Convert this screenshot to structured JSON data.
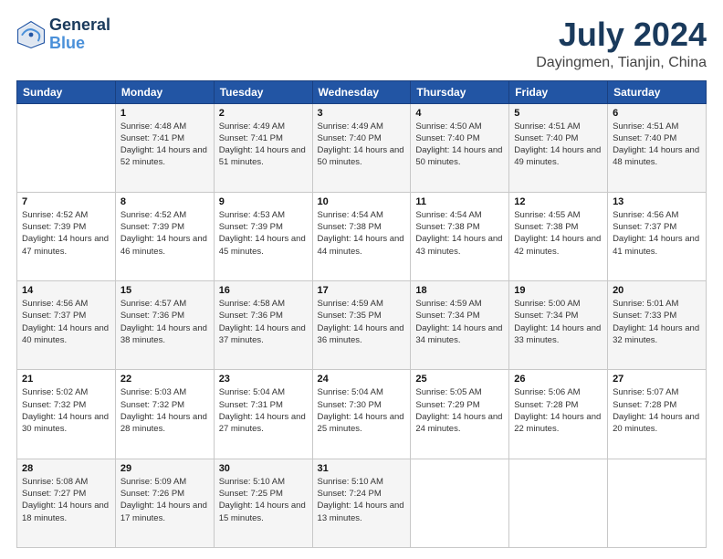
{
  "logo": {
    "line1": "General",
    "line2": "Blue"
  },
  "title": {
    "month_year": "July 2024",
    "location": "Dayingmen, Tianjin, China"
  },
  "days_header": [
    "Sunday",
    "Monday",
    "Tuesday",
    "Wednesday",
    "Thursday",
    "Friday",
    "Saturday"
  ],
  "weeks": [
    [
      {
        "day": "",
        "sunrise": "",
        "sunset": "",
        "daylight": ""
      },
      {
        "day": "1",
        "sunrise": "Sunrise: 4:48 AM",
        "sunset": "Sunset: 7:41 PM",
        "daylight": "Daylight: 14 hours and 52 minutes."
      },
      {
        "day": "2",
        "sunrise": "Sunrise: 4:49 AM",
        "sunset": "Sunset: 7:41 PM",
        "daylight": "Daylight: 14 hours and 51 minutes."
      },
      {
        "day": "3",
        "sunrise": "Sunrise: 4:49 AM",
        "sunset": "Sunset: 7:40 PM",
        "daylight": "Daylight: 14 hours and 50 minutes."
      },
      {
        "day": "4",
        "sunrise": "Sunrise: 4:50 AM",
        "sunset": "Sunset: 7:40 PM",
        "daylight": "Daylight: 14 hours and 50 minutes."
      },
      {
        "day": "5",
        "sunrise": "Sunrise: 4:51 AM",
        "sunset": "Sunset: 7:40 PM",
        "daylight": "Daylight: 14 hours and 49 minutes."
      },
      {
        "day": "6",
        "sunrise": "Sunrise: 4:51 AM",
        "sunset": "Sunset: 7:40 PM",
        "daylight": "Daylight: 14 hours and 48 minutes."
      }
    ],
    [
      {
        "day": "7",
        "sunrise": "Sunrise: 4:52 AM",
        "sunset": "Sunset: 7:39 PM",
        "daylight": "Daylight: 14 hours and 47 minutes."
      },
      {
        "day": "8",
        "sunrise": "Sunrise: 4:52 AM",
        "sunset": "Sunset: 7:39 PM",
        "daylight": "Daylight: 14 hours and 46 minutes."
      },
      {
        "day": "9",
        "sunrise": "Sunrise: 4:53 AM",
        "sunset": "Sunset: 7:39 PM",
        "daylight": "Daylight: 14 hours and 45 minutes."
      },
      {
        "day": "10",
        "sunrise": "Sunrise: 4:54 AM",
        "sunset": "Sunset: 7:38 PM",
        "daylight": "Daylight: 14 hours and 44 minutes."
      },
      {
        "day": "11",
        "sunrise": "Sunrise: 4:54 AM",
        "sunset": "Sunset: 7:38 PM",
        "daylight": "Daylight: 14 hours and 43 minutes."
      },
      {
        "day": "12",
        "sunrise": "Sunrise: 4:55 AM",
        "sunset": "Sunset: 7:38 PM",
        "daylight": "Daylight: 14 hours and 42 minutes."
      },
      {
        "day": "13",
        "sunrise": "Sunrise: 4:56 AM",
        "sunset": "Sunset: 7:37 PM",
        "daylight": "Daylight: 14 hours and 41 minutes."
      }
    ],
    [
      {
        "day": "14",
        "sunrise": "Sunrise: 4:56 AM",
        "sunset": "Sunset: 7:37 PM",
        "daylight": "Daylight: 14 hours and 40 minutes."
      },
      {
        "day": "15",
        "sunrise": "Sunrise: 4:57 AM",
        "sunset": "Sunset: 7:36 PM",
        "daylight": "Daylight: 14 hours and 38 minutes."
      },
      {
        "day": "16",
        "sunrise": "Sunrise: 4:58 AM",
        "sunset": "Sunset: 7:36 PM",
        "daylight": "Daylight: 14 hours and 37 minutes."
      },
      {
        "day": "17",
        "sunrise": "Sunrise: 4:59 AM",
        "sunset": "Sunset: 7:35 PM",
        "daylight": "Daylight: 14 hours and 36 minutes."
      },
      {
        "day": "18",
        "sunrise": "Sunrise: 4:59 AM",
        "sunset": "Sunset: 7:34 PM",
        "daylight": "Daylight: 14 hours and 34 minutes."
      },
      {
        "day": "19",
        "sunrise": "Sunrise: 5:00 AM",
        "sunset": "Sunset: 7:34 PM",
        "daylight": "Daylight: 14 hours and 33 minutes."
      },
      {
        "day": "20",
        "sunrise": "Sunrise: 5:01 AM",
        "sunset": "Sunset: 7:33 PM",
        "daylight": "Daylight: 14 hours and 32 minutes."
      }
    ],
    [
      {
        "day": "21",
        "sunrise": "Sunrise: 5:02 AM",
        "sunset": "Sunset: 7:32 PM",
        "daylight": "Daylight: 14 hours and 30 minutes."
      },
      {
        "day": "22",
        "sunrise": "Sunrise: 5:03 AM",
        "sunset": "Sunset: 7:32 PM",
        "daylight": "Daylight: 14 hours and 28 minutes."
      },
      {
        "day": "23",
        "sunrise": "Sunrise: 5:04 AM",
        "sunset": "Sunset: 7:31 PM",
        "daylight": "Daylight: 14 hours and 27 minutes."
      },
      {
        "day": "24",
        "sunrise": "Sunrise: 5:04 AM",
        "sunset": "Sunset: 7:30 PM",
        "daylight": "Daylight: 14 hours and 25 minutes."
      },
      {
        "day": "25",
        "sunrise": "Sunrise: 5:05 AM",
        "sunset": "Sunset: 7:29 PM",
        "daylight": "Daylight: 14 hours and 24 minutes."
      },
      {
        "day": "26",
        "sunrise": "Sunrise: 5:06 AM",
        "sunset": "Sunset: 7:28 PM",
        "daylight": "Daylight: 14 hours and 22 minutes."
      },
      {
        "day": "27",
        "sunrise": "Sunrise: 5:07 AM",
        "sunset": "Sunset: 7:28 PM",
        "daylight": "Daylight: 14 hours and 20 minutes."
      }
    ],
    [
      {
        "day": "28",
        "sunrise": "Sunrise: 5:08 AM",
        "sunset": "Sunset: 7:27 PM",
        "daylight": "Daylight: 14 hours and 18 minutes."
      },
      {
        "day": "29",
        "sunrise": "Sunrise: 5:09 AM",
        "sunset": "Sunset: 7:26 PM",
        "daylight": "Daylight: 14 hours and 17 minutes."
      },
      {
        "day": "30",
        "sunrise": "Sunrise: 5:10 AM",
        "sunset": "Sunset: 7:25 PM",
        "daylight": "Daylight: 14 hours and 15 minutes."
      },
      {
        "day": "31",
        "sunrise": "Sunrise: 5:10 AM",
        "sunset": "Sunset: 7:24 PM",
        "daylight": "Daylight: 14 hours and 13 minutes."
      },
      {
        "day": "",
        "sunrise": "",
        "sunset": "",
        "daylight": ""
      },
      {
        "day": "",
        "sunrise": "",
        "sunset": "",
        "daylight": ""
      },
      {
        "day": "",
        "sunrise": "",
        "sunset": "",
        "daylight": ""
      }
    ]
  ]
}
